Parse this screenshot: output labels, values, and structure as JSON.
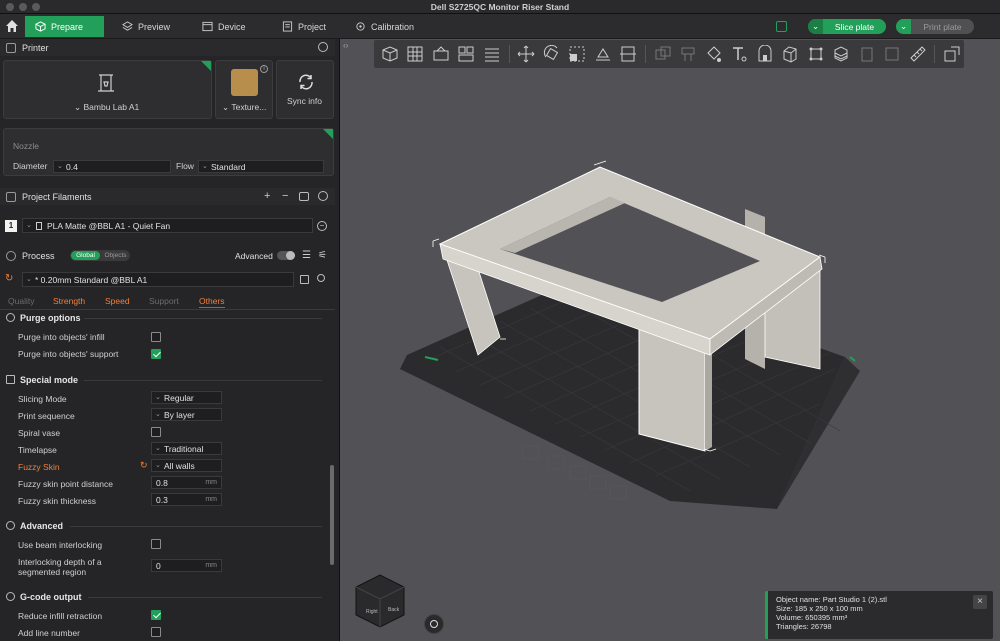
{
  "window": {
    "title": "Dell S2725QC Monitor Riser Stand"
  },
  "tabs": [
    {
      "label": "Prepare",
      "active": true
    },
    {
      "label": "Preview"
    },
    {
      "label": "Device"
    },
    {
      "label": "Project"
    },
    {
      "label": "Calibration"
    }
  ],
  "actions": {
    "slice": "Slice plate",
    "print": "Print plate"
  },
  "printer": {
    "header": "Printer",
    "name": "Bambu Lab A1",
    "plate": "Texture...",
    "sync": "Sync info",
    "nozzle_title": "Nozzle",
    "diameter_label": "Diameter",
    "diameter": "0.4",
    "flow_label": "Flow",
    "flow": "Standard"
  },
  "filaments": {
    "header": "Project Filaments",
    "items": [
      {
        "index": "1",
        "name": "PLA Matte @BBL A1 - Quiet Fan",
        "color": "#f2f2f0"
      }
    ]
  },
  "process": {
    "header": "Process",
    "toggle": [
      "Global",
      "Objects"
    ],
    "advanced_label": "Advanced",
    "preset": "* 0.20mm Standard @BBL A1",
    "subtabs": [
      "Quality",
      "Strength",
      "Speed",
      "Support",
      "Others"
    ],
    "active_subtab": "Others"
  },
  "settings": {
    "purge": {
      "title": "Purge options",
      "infill_label": "Purge into objects' infill",
      "support_label": "Purge into objects' support"
    },
    "special": {
      "title": "Special mode",
      "slicing_label": "Slicing Mode",
      "slicing": "Regular",
      "sequence_label": "Print sequence",
      "sequence": "By layer",
      "spiral_label": "Spiral vase",
      "timelapse_label": "Timelapse",
      "timelapse": "Traditional",
      "fuzzy_label": "Fuzzy Skin",
      "fuzzy": "All walls",
      "fuzzy_dist_label": "Fuzzy skin point distance",
      "fuzzy_dist": "0.8",
      "fuzzy_thick_label": "Fuzzy skin thickness",
      "fuzzy_thick": "0.3",
      "unit": "mm"
    },
    "advanced": {
      "title": "Advanced",
      "beam_label": "Use beam interlocking",
      "depth_label_1": "Interlocking depth of a",
      "depth_label_2": "segmented region",
      "depth": "0"
    },
    "gcode": {
      "title": "G-code output",
      "reduce_label": "Reduce infill retraction",
      "line_label": "Add line number"
    }
  },
  "object_info": {
    "name": "Object name: Part Studio 1 (2).stl",
    "size": "Size: 185 x 250 x 100 mm",
    "volume": "Volume: 650395 mm³",
    "triangles": "Triangles: 26798"
  },
  "nav_cube": {
    "left": "Right",
    "right": "Back",
    "top": "Top"
  },
  "colors": {
    "accent": "#22a05a",
    "accent_orange": "#f0813a",
    "viewport_bg": "#525256",
    "plate": "#2b2b2d",
    "model": "#bdbbb3"
  }
}
